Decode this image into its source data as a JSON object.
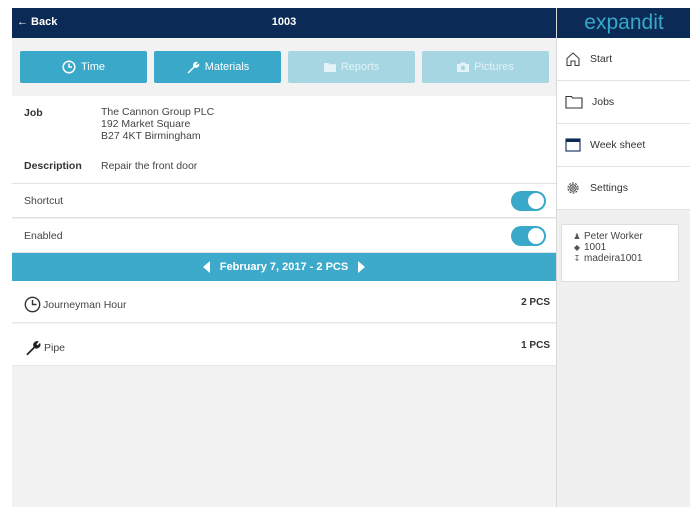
{
  "header": {
    "back_label": "← Back",
    "title": "1003"
  },
  "tabs": [
    {
      "label": "Time",
      "icon": "clock-icon",
      "state": "active"
    },
    {
      "label": "Materials",
      "icon": "wrench-icon",
      "state": "active"
    },
    {
      "label": "Reports",
      "icon": "folder-icon",
      "state": "disabled"
    },
    {
      "label": "Pictures",
      "icon": "camera-icon",
      "state": "disabled"
    }
  ],
  "job": {
    "job_label": "Job",
    "customer": "The Cannon Group PLC",
    "address1": "192 Market Square",
    "address2": "B27 4KT Birmingham",
    "description_label": "Description",
    "description": "Repair the front door"
  },
  "toggles": [
    {
      "label": "Shortcut",
      "on": true
    },
    {
      "label": "Enabled",
      "on": true
    }
  ],
  "date_nav": {
    "text": "February 7, 2017 - 2 PCS"
  },
  "items": [
    {
      "name": "Journeyman Hour",
      "qty": "2 PCS",
      "icon": "clock-icon"
    },
    {
      "name": "Pipe",
      "qty": "1 PCS",
      "icon": "wrench-icon"
    }
  ],
  "sidebar": {
    "logo": "expandit",
    "nav": [
      {
        "label": "Start",
        "icon": "home-icon"
      },
      {
        "label": "Jobs",
        "icon": "folder-icon"
      },
      {
        "label": "Week sheet",
        "icon": "calendar-icon"
      },
      {
        "label": "Settings",
        "icon": "gear-icon"
      }
    ],
    "user": {
      "name": "Peter Worker",
      "id": "1001",
      "login": "madeira1001"
    }
  },
  "colors": {
    "header_bg": "#0b2a55",
    "accent": "#39a8c9",
    "accent_disabled": "#a7d6e3",
    "panel_bg": "#f2f2f2"
  }
}
